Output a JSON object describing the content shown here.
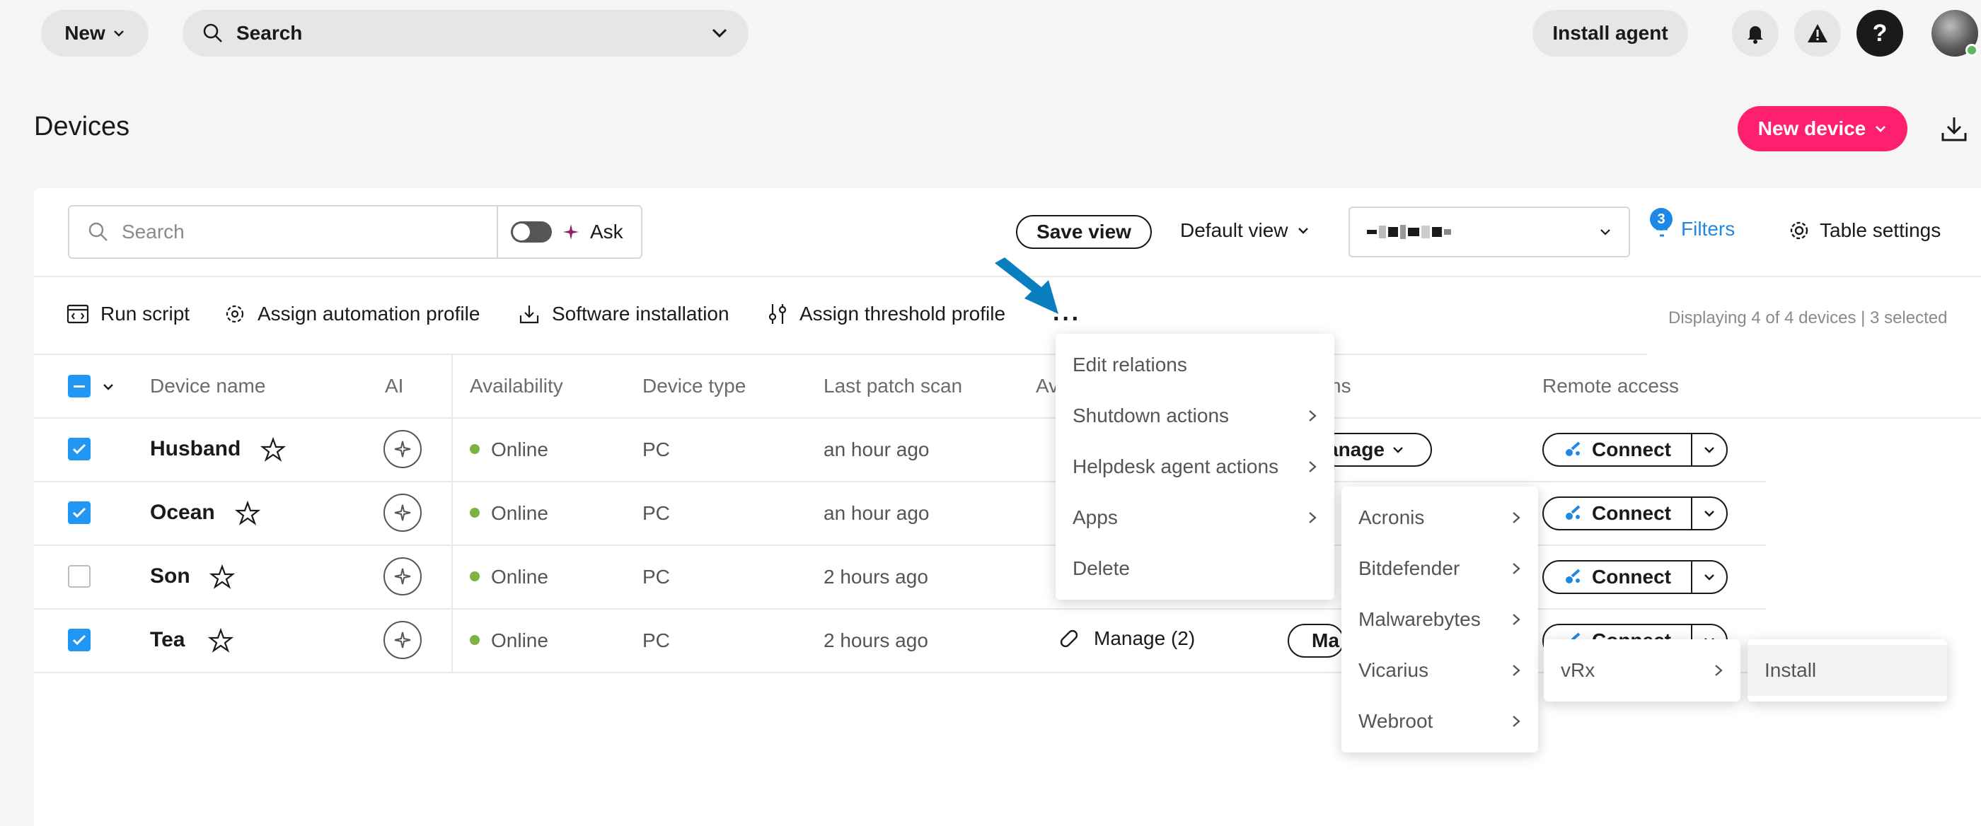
{
  "topbar": {
    "new_label": "New",
    "search_label": "Search",
    "install_agent_label": "Install agent",
    "help_label": "?"
  },
  "page": {
    "title": "Devices",
    "new_device_label": "New device"
  },
  "toolbar": {
    "search_placeholder": "Search",
    "ask_label": "Ask",
    "save_view_label": "Save view",
    "default_view_label": "Default view",
    "filters_label": "Filters",
    "filters_count": "3",
    "table_settings_label": "Table settings"
  },
  "actions": {
    "run_script": "Run script",
    "assign_automation": "Assign automation profile",
    "software_installation": "Software installation",
    "assign_threshold": "Assign threshold profile",
    "more": "···",
    "displaying": "Displaying 4 of 4 devices | 3 selected"
  },
  "table": {
    "headers": {
      "device_name": "Device name",
      "ai": "AI",
      "availability": "Availability",
      "device_type": "Device type",
      "last_patch_scan": "Last patch scan",
      "av": "Av",
      "actions": "ns",
      "remote_access": "Remote access"
    },
    "rows": [
      {
        "name": "Husband",
        "availability": "Online",
        "type": "PC",
        "last_patch": "an hour ago",
        "selected": true
      },
      {
        "name": "Ocean",
        "availability": "Online",
        "type": "PC",
        "last_patch": "an hour ago",
        "selected": true
      },
      {
        "name": "Son",
        "availability": "Online",
        "type": "PC",
        "last_patch": "2 hours ago",
        "selected": false
      },
      {
        "name": "Tea",
        "availability": "Online",
        "type": "PC",
        "last_patch": "2 hours ago",
        "selected": true
      }
    ],
    "connect_label": "Connect",
    "manage_partial_1": "anage",
    "manage_partial_2": "a",
    "manage_partial_3": "Ma",
    "av_manage_label": "Manage (2)"
  },
  "more_menu": {
    "items": [
      "Edit relations",
      "Shutdown actions",
      "Helpdesk agent actions",
      "Apps",
      "Delete"
    ]
  },
  "apps_menu": {
    "items": [
      "Acronis",
      "Bitdefender",
      "Malwarebytes",
      "Vicarius",
      "Webroot"
    ]
  },
  "vicarius_menu": {
    "items": [
      "vRx"
    ]
  },
  "vrx_menu": {
    "items": [
      "Install"
    ]
  },
  "colors": {
    "accent_blue": "#2196f3",
    "brand_pink": "#ff1f6f",
    "online_green": "#7cb342"
  }
}
